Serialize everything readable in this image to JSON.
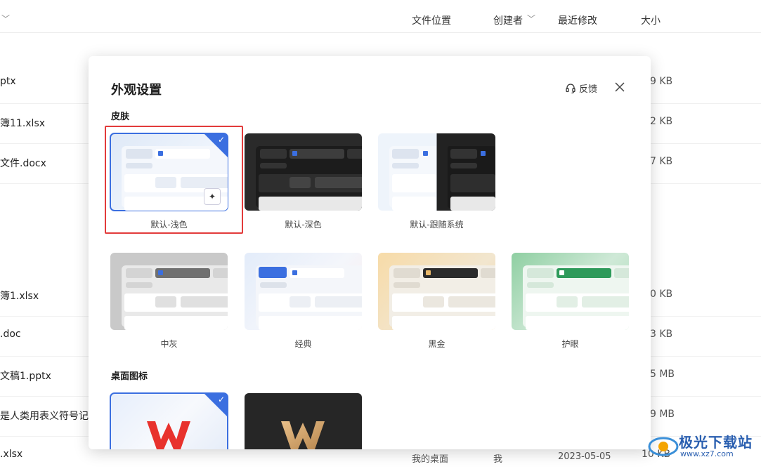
{
  "file_list": {
    "columns": {
      "location": "文件位置",
      "creator": "创建者",
      "modified": "最近修改",
      "size": "大小"
    },
    "rows": [
      {
        "name": "ptx",
        "size": "9 KB"
      },
      {
        "name": "簿11.xlsx",
        "size": "2 KB"
      },
      {
        "name": "文件.docx",
        "size": "7 KB"
      },
      {
        "name": "簿1.xlsx",
        "size": "0 KB"
      },
      {
        "name": ".doc",
        "size": "3 KB"
      },
      {
        "name": "文稿1.pptx",
        "size": "5 MB"
      },
      {
        "name": "是人类用表义符号记",
        "size": "9 MB"
      },
      {
        "name": ".xlsx",
        "location": "我的桌面",
        "creator": "我",
        "modified": "2023-05-05",
        "size": "10 KB"
      }
    ]
  },
  "modal": {
    "title": "外观设置",
    "feedback_label": "反馈",
    "skin_section": "皮肤",
    "skins": [
      {
        "label": "默认-浅色",
        "selected": true
      },
      {
        "label": "默认-深色",
        "selected": false
      },
      {
        "label": "默认-跟随系统",
        "selected": false
      },
      {
        "label": "中灰",
        "selected": false
      },
      {
        "label": "经典",
        "selected": false
      },
      {
        "label": "黑金",
        "selected": false
      },
      {
        "label": "护眼",
        "selected": false
      }
    ],
    "icon_section": "桌面图标",
    "icons": [
      {
        "name": "wps-red-icon",
        "selected": true
      },
      {
        "name": "wps-gold-icon",
        "selected": false
      }
    ]
  },
  "watermark": {
    "text": "极光下载站",
    "sub": "www.xz7.com"
  },
  "colors": {
    "accent": "#3b6fe0",
    "highlight_box": "#e23b3b"
  }
}
